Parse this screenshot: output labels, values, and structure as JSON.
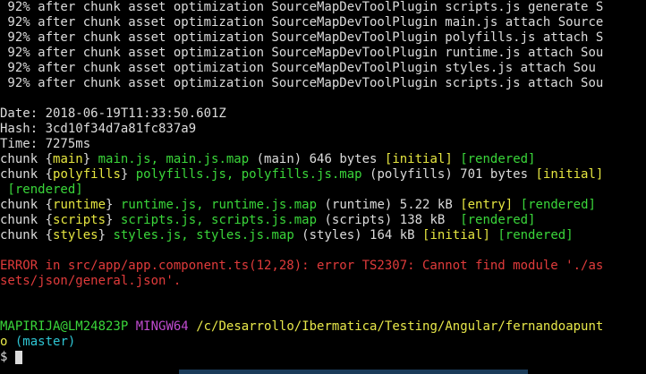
{
  "progress_lines": [
    " 92% after chunk asset optimization SourceMapDevToolPlugin scripts.js generate S",
    " 92% after chunk asset optimization SourceMapDevToolPlugin main.js attach Source",
    " 92% after chunk asset optimization SourceMapDevToolPlugin polyfills.js attach S",
    " 92% after chunk asset optimization SourceMapDevToolPlugin runtime.js attach Sou",
    " 92% after chunk asset optimization SourceMapDevToolPlugin styles.js attach Sou",
    " 92% after chunk asset optimization SourceMapDevToolPlugin scripts.js attach Sou"
  ],
  "build": {
    "date": "Date: 2018-06-19T11:33:50.601Z",
    "hash": "Hash: 3cd10f34d7a81fc837a9",
    "time": "Time: 7275ms"
  },
  "chunks": {
    "main": {
      "pre": "chunk {",
      "name": "main",
      "mid": "} ",
      "files": "main.js, main.js.map",
      "info": " (main) 646 bytes ",
      "tag1": "[initial]",
      "sp": " ",
      "tag2": "[rendered]"
    },
    "polyfills": {
      "pre": "chunk {",
      "name": "polyfills",
      "mid": "} ",
      "files": "polyfills.js, polyfills.js.map",
      "info": " (polyfills) 701 bytes ",
      "tag1": "[initial]",
      "wrap": " [rendered]"
    },
    "runtime": {
      "pre": "chunk {",
      "name": "runtime",
      "mid": "} ",
      "files": "runtime.js, runtime.js.map",
      "info": " (runtime) 5.22 kB ",
      "tag1": "[entry]",
      "sp": " ",
      "tag2": "[rendered]"
    },
    "scripts": {
      "pre": "chunk {",
      "name": "scripts",
      "mid": "} ",
      "files": "scripts.js, scripts.js.map",
      "info": " (scripts) 138 kB  ",
      "tag2": "[rendered]"
    },
    "styles": {
      "pre": "chunk {",
      "name": "styles",
      "mid": "} ",
      "files": "styles.js, styles.js.map",
      "info": " (styles) 164 kB ",
      "tag1": "[initial]",
      "sp": " ",
      "tag2": "[rendered]"
    }
  },
  "error": {
    "line1": "ERROR in src/app/app.component.ts(12,28): error TS2307: Cannot find module './as",
    "line2": "sets/json/general.json'."
  },
  "prompt": {
    "user": "MAPIRIJA@LM24823P",
    "env": "MINGW64",
    "path": "/c/Desarrollo/Ibermatica/Testing/Angular/fernandoapunt",
    "path_wrap": "o",
    "branch": " (master)",
    "symbol": "$ "
  },
  "colors": {
    "background": "#000000",
    "text": "#dcdcdc",
    "cyan": "#2ec5d3",
    "green": "#3ad63a",
    "yellow": "#e6e640",
    "red": "#e03b3b",
    "magenta": "#c04bd0"
  }
}
